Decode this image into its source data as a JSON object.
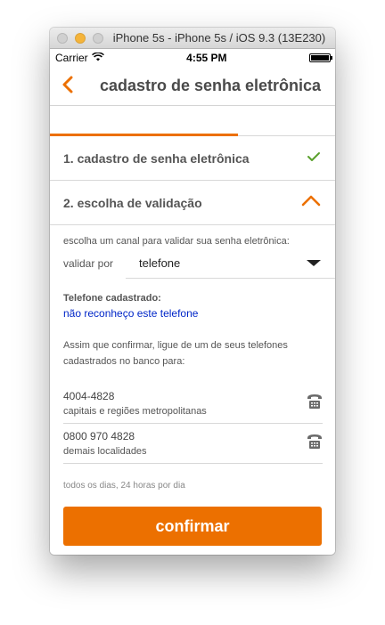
{
  "window": {
    "title": "iPhone 5s - iPhone 5s / iOS 9.3 (13E230)"
  },
  "status_bar": {
    "carrier": "Carrier",
    "time": "4:55 PM"
  },
  "nav": {
    "title": "cadastro de senha eletrônica"
  },
  "progress": {
    "fraction": 0.66
  },
  "steps": [
    {
      "label": "1. cadastro de senha eletrônica",
      "state": "completed",
      "icon": "check-icon"
    },
    {
      "label": "2. escolha de validação",
      "state": "expanded",
      "icon": "chevron-up-icon"
    }
  ],
  "validation": {
    "instruction": "escolha um canal para validar sua senha eletrônica:",
    "select_label": "validar por",
    "select_value": "telefone",
    "registered_phone_label": "Telefone cadastrado:",
    "unrecognized_link": "não reconheço este telefone",
    "info": "Assim que confirmar, ligue de um de seus telefones cadastrados no banco para:",
    "phones": [
      {
        "number": "4004-4828",
        "description": "capitais e regiões metropolitanas"
      },
      {
        "number": "0800 970 4828",
        "description": "demais localidades"
      }
    ],
    "hours": "todos os dias, 24 horas por dia"
  },
  "confirm_button": "confirmar",
  "colors": {
    "accent": "#ec7000",
    "check": "#5aa02c",
    "link": "#0026c8"
  }
}
